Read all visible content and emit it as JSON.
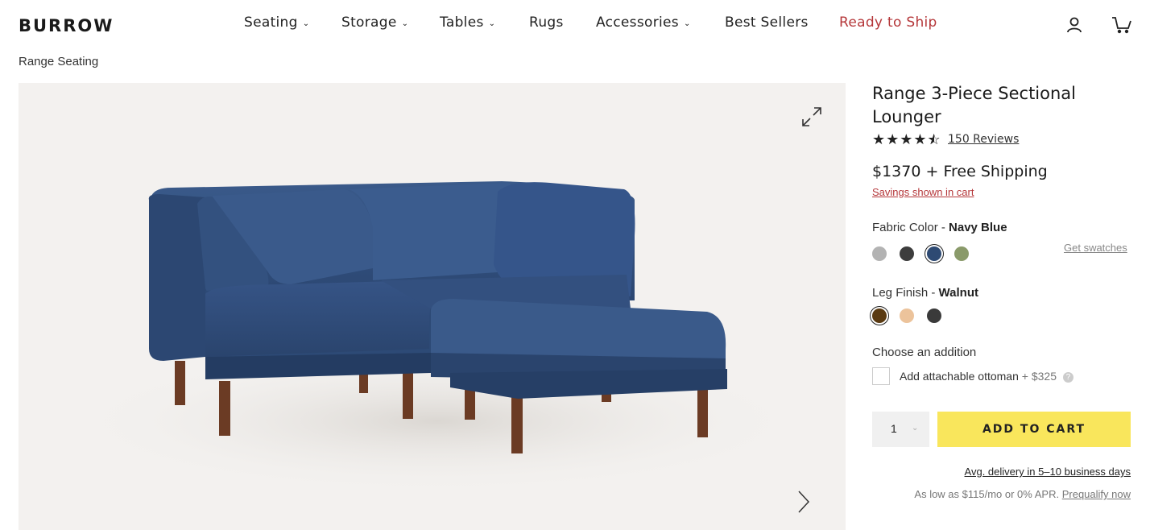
{
  "header": {
    "logo": "BURROW",
    "nav": [
      {
        "label": "Seating",
        "dropdown": true
      },
      {
        "label": "Storage",
        "dropdown": true
      },
      {
        "label": "Tables",
        "dropdown": true
      },
      {
        "label": "Rugs",
        "dropdown": false
      },
      {
        "label": "Accessories",
        "dropdown": true
      },
      {
        "label": "Best Sellers",
        "dropdown": false
      },
      {
        "label": "Ready to Ship",
        "dropdown": false
      }
    ],
    "icons": [
      "account-icon",
      "cart-icon"
    ]
  },
  "breadcrumb": "Range Seating",
  "product": {
    "title": "Range 3-Piece Sectional Lounger",
    "rating": 4.5,
    "reviews_label": "150 Reviews",
    "price": "$1370",
    "shipping": "+ Free Shipping",
    "savings": "Savings shown in cart",
    "fabric": {
      "label": "Fabric Color - ",
      "selected": "Navy Blue",
      "swatches": [
        "#b3b3b3",
        "#3d3d3d",
        "#2e4a73",
        "#8a9a6a"
      ],
      "selected_index": 2,
      "get_swatches": "Get swatches"
    },
    "leg": {
      "label": "Leg Finish - ",
      "selected": "Walnut",
      "swatches": [
        "#5a3a12",
        "#ecc39b",
        "#3a3a3a"
      ],
      "selected_index": 0
    },
    "addition": {
      "label": "Choose an addition",
      "option": "Add attachable ottoman",
      "price": "+ $325",
      "help": "?"
    },
    "quantity": "1",
    "add_to_cart": "ADD TO CART",
    "delivery": "Avg. delivery in 5–10 business days",
    "finance_text": "As low as $115/mo or 0% APR.",
    "finance_link": "Prequalify now"
  },
  "colors": {
    "accent_red": "#b5373a",
    "cart_yellow": "#f9e65c",
    "sofa_blue": "#2f4d7b",
    "leg_wood": "#6b3b24"
  }
}
